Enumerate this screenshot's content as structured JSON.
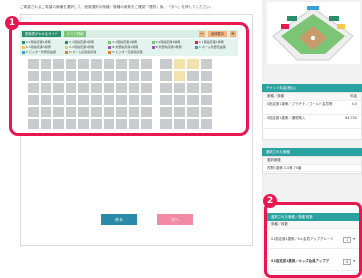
{
  "instruction": "ご希望されるご希望の席種を選択して、座席選択の席種／席種の席数をご確認「選択」後、「次へ」を押してください。",
  "seat_map": {
    "tabs": [
      "座席表がわかるガイド",
      "エリア詳細"
    ],
    "zoom_label": "全体表示",
    "legend": [
      {
        "color": "#2a8e6a",
        "label": "S 1階指定席1塁側"
      },
      {
        "color": "#2a8e6a",
        "label": "S 1階指定席3塁側"
      },
      {
        "color": "#7cc576",
        "label": "S 2階指定席1塁側"
      },
      {
        "color": "#7cc576",
        "label": "S 2階指定席3塁側"
      },
      {
        "color": "#e8174f",
        "label": "A 1階指定席1塁側"
      },
      {
        "color": "#f2c94c",
        "label": "A 1階指定席3塁側"
      },
      {
        "color": "#f2c94c",
        "label": "A 2階指定席1塁側"
      },
      {
        "color": "#9b59b6",
        "label": "B 外野指定席1塁側"
      },
      {
        "color": "#9b59b6",
        "label": "B 外野指定席3塁側"
      },
      {
        "color": "#3aa0d8",
        "label": "C ホーム外野自由席"
      },
      {
        "color": "#3aa0d8",
        "label": "C ビジター外野自由席"
      },
      {
        "color": "#e67e22",
        "label": "D ホーム応援指定席"
      },
      {
        "color": "#e67e22",
        "label": "D ビジター応援指定席"
      }
    ]
  },
  "badges": {
    "one": "1",
    "two": "2"
  },
  "buttons": {
    "back": "戻る",
    "next": "次へ"
  },
  "side": {
    "ticket_panel_title": "チケット料金(税込)",
    "ticket_cols": [
      "席種／券種",
      "料金"
    ],
    "tickets": [
      {
        "name": "S指定席1塁側／プラチナ／ゴールド会員等",
        "price": "4,0"
      },
      {
        "name": "S指定席1塁側／通常購入",
        "price": "¥4,700"
      }
    ],
    "selected_panel_title": "選択された席種",
    "selected_col": "選択席種",
    "selected": [
      {
        "name": "内野1塁側 3,0席 70番"
      }
    ],
    "qty_panel_title": "選択された席種／券種 枚数",
    "qty_sub": "券種／枚数",
    "qty_rows": [
      {
        "name": "S1指定席1塁側／S-L会員アップグレード",
        "qty": "1"
      },
      {
        "name": "S1指定席1塁側／キッズ会員アップグ",
        "qty": "0"
      }
    ]
  }
}
